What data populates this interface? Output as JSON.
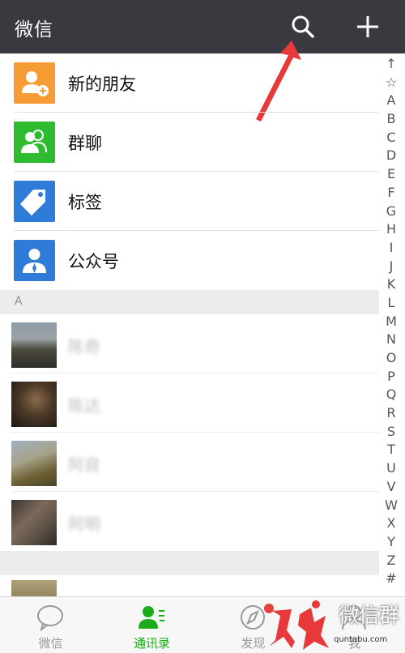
{
  "header": {
    "title": "微信"
  },
  "functions": [
    {
      "label": "新的朋友",
      "icon": "new-friends-icon",
      "color": "#f79c35"
    },
    {
      "label": "群聊",
      "icon": "group-chat-icon",
      "color": "#2fbb30"
    },
    {
      "label": "标签",
      "icon": "tag-icon",
      "color": "#2e7cd7"
    },
    {
      "label": "公众号",
      "icon": "official-accounts-icon",
      "color": "#2e7cd7"
    }
  ],
  "sections": [
    "A"
  ],
  "contacts": [
    {
      "name": "陈奇"
    },
    {
      "name": "陈达"
    },
    {
      "name": "阿良"
    },
    {
      "name": "阿明"
    }
  ],
  "index": [
    "↑",
    "☆",
    "A",
    "B",
    "C",
    "D",
    "E",
    "F",
    "G",
    "H",
    "I",
    "J",
    "K",
    "L",
    "M",
    "N",
    "O",
    "P",
    "Q",
    "R",
    "S",
    "T",
    "U",
    "V",
    "W",
    "X",
    "Y",
    "Z",
    "#"
  ],
  "tabs": [
    {
      "label": "微信",
      "icon": "chat-bubble-icon"
    },
    {
      "label": "通讯录",
      "icon": "contacts-icon",
      "active": true
    },
    {
      "label": "发现",
      "icon": "compass-icon",
      "badge": true
    },
    {
      "label": "我",
      "icon": "profile-icon"
    }
  ],
  "watermark": {
    "text": "微信群",
    "url": "quntabu.com"
  },
  "colors": {
    "header_bg": "#393a3f",
    "accent_green": "#1aad19",
    "badge_red": "#e64340"
  }
}
